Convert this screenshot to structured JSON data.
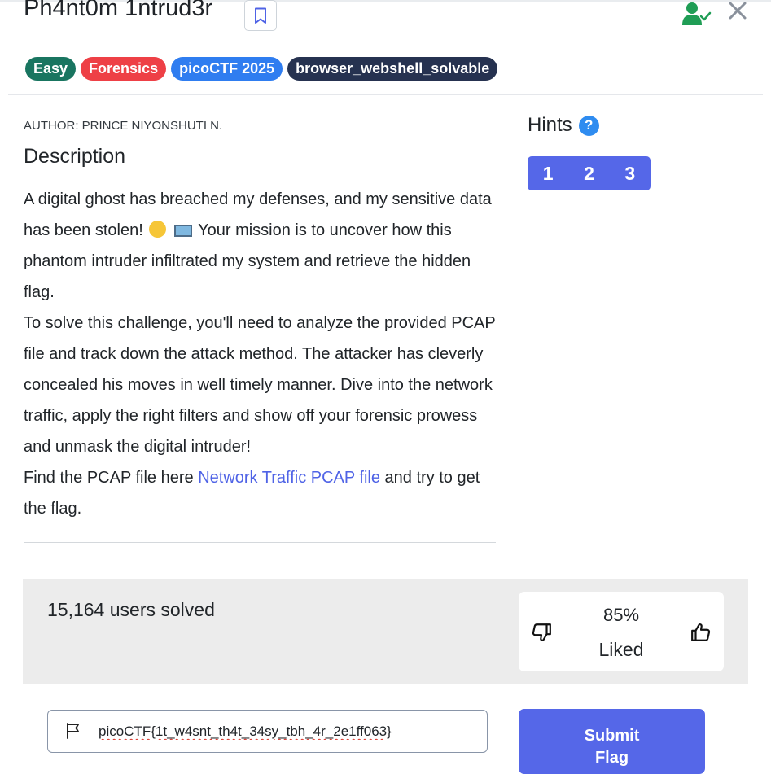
{
  "challenge": {
    "title": "Ph4nt0m 1ntrud3r",
    "tags": [
      {
        "label": "Easy",
        "color": "#197560"
      },
      {
        "label": "Forensics",
        "color": "#ee4046"
      },
      {
        "label": "picoCTF 2025",
        "color": "#2f7df0"
      },
      {
        "label": "browser_webshell_solvable",
        "color": "#263250"
      }
    ],
    "author": "AUTHOR: PRINCE NIYONSHUTI N.",
    "description_heading": "Description",
    "description": {
      "p1_before_emoji": "A digital ghost has breached my defenses, and my sensitive data has been stolen!",
      "emojis": [
        "face-screaming-in-fear-icon",
        "laptop-icon"
      ],
      "p1_after_emoji": "Your mission is to uncover how this phantom intruder infiltrated my system and retrieve the hidden flag.",
      "p2": "To solve this challenge, you'll need to analyze the provided PCAP file and track down the attack method. The attacker has cleverly concealed his moves in well timely manner. Dive into the network traffic, apply the right filters and show off your forensic prowess and unmask the digital intruder!",
      "p3_before_link": "Find the PCAP file here",
      "link_text": "Network Traffic PCAP file",
      "p3_after_link": "and try to get the flag."
    }
  },
  "hints": {
    "heading": "Hints",
    "help_icon_glyph": "?",
    "buttons": [
      "1",
      "2",
      "3"
    ]
  },
  "stats": {
    "solved_text": "15,164 users solved",
    "liked_percent": "85%",
    "liked_label": "Liked"
  },
  "flag_form": {
    "input_value": "picoCTF{1t_w4snt_th4t_34sy_tbh_4r_2e1ff063}",
    "submit_line1": "Submit",
    "submit_line2": "Flag"
  },
  "colors": {
    "accent": "#5567e8",
    "link": "#4f63e6",
    "panel_bg": "#ececec",
    "user_check_icon": "#1f9d55"
  }
}
